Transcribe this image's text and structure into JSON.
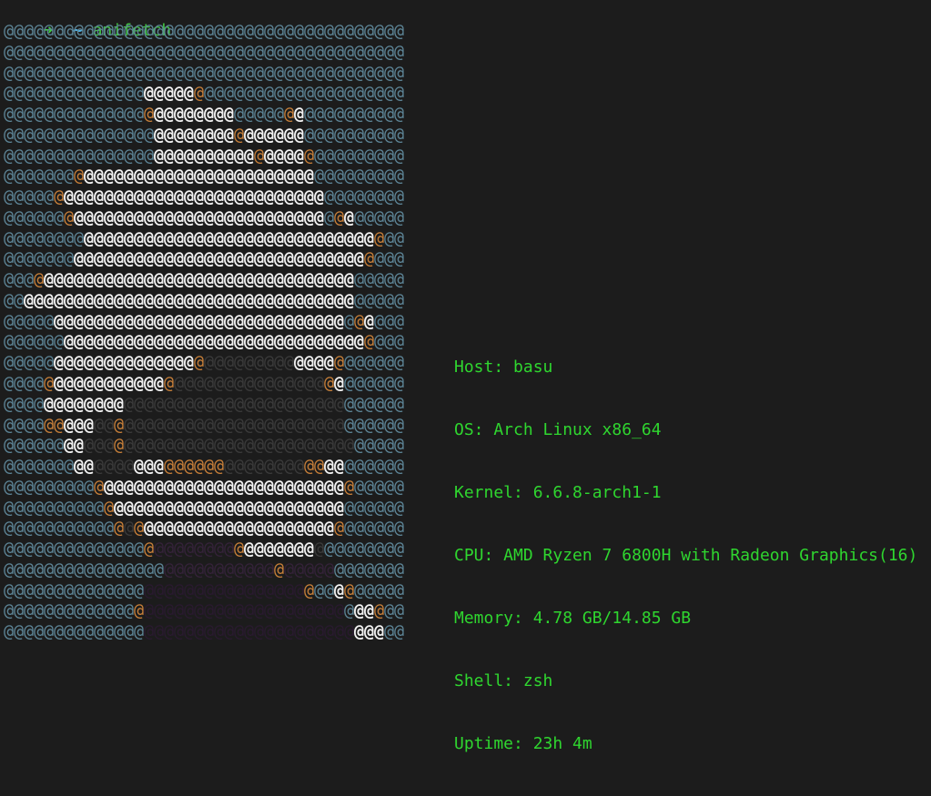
{
  "prompt": {
    "arrow": "➜",
    "dir": "~",
    "command": "anifetch"
  },
  "art": {
    "glyph": "@",
    "columns": 40,
    "palette": {
      "g": "#5d8597",
      "d": "#3b3b3b",
      "k": "#282828",
      "w": "#f2f2f2",
      "l": "#d6ccc4",
      "o": "#c8803a",
      "b": "#8a5528",
      "p": "#35223a",
      "q": "#2a1a30"
    },
    "rows": [
      "gggggggggggggggggggggggggggggggggggggggg",
      "gggggggggggggggggggggggggggggggggggggggg",
      "gggggggggggggggggggggggggggggggggggggggg",
      "ggggggggggggggwwwwwoggggggggggggggggggggg",
      "ggggggggggggggowwwwwwwwgggggowgggggggggggg",
      "gggggggggggggggwwwwwwwwowwwwwwggggggggggg",
      "gggggggggggggggwwwwwwwwwwowwwwogggggggggg",
      "gggggggowwwwwwwwwwwwwwwwwwwwwwwgggggggggg",
      "gggggowwwwwwwwwwwwwwwwwwwwwwwwwwgggggggg",
      "ggggggowwwwwwwwwwwwwwwwwwwwwwwwwgowggggg",
      "ggggggggwwwwwwwwwwwwwwwwwwwwwwwwwwwwwogggg",
      "gggggggwwwwwwwwwwwwwwwwwwwwwwwwwwwwwogggg",
      "gggowwwwwwwwwwwwwwwwwwwwwwwwwwwwwwwgggg",
      "ggwwwwwwwwwwwwwwwwwwwwwwwwwwwwwwwwwgggg",
      "gggggwwwwwwwwwwwwwwwwwwwwwwwwwwwwwgowggg",
      "ggggggwwwwwwwwwwwwwwwwwwwwwwwwwwwwwwogggg",
      "gggggwwwwwwwwwwwwwwodddddddddwwwwoggggg",
      "ggggowwwwwwwwwwwodddddddddddddddowggggggg",
      "ggggwwwwwwwwddddddddddddddddddddddgggggg",
      "ggggoowwwddoddddddddddddddddddddddgggggg",
      "ggggggwwdddodddddddddddddddddddddddgggggg",
      "gggggggwwddddwwwooooooddddddddoowwgggggg",
      "gggggggggowwwwwwwwwwwwwwwwwwwwwwwwogggggg",
      "ggggggggggowwwwwwwwwwwwwwwwwwwwwwwgggggg",
      "gggggggggggodowwwwwwwwwwwwwwwwwwwogggggg",
      "ggggggggggggggoppppppppowwwwwwwdgggggggg",
      "ggggggggggggggggpppppppppppopppppgggggggg",
      "ggggggggggggggqqqqqqqqqqqqqqqqoggwogggg",
      "gggggggggggggoqqqqqqqqqqqqqqqqqqqqgwwogggg",
      "ggggggggggggggqqqqqqqqqqqqqqqqqqqqqwwwgggg"
    ]
  },
  "info": {
    "host": "Host: basu",
    "os": "OS: Arch Linux x86_64",
    "kernel": "Kernel: 6.6.8-arch1-1",
    "cpu": "CPU: AMD Ryzen 7 6800H with Radeon Graphics(16)",
    "memory": "Memory: 4.78 GB/14.85 GB",
    "shell": "Shell: zsh",
    "uptime": "Uptime: 23h 4m"
  }
}
